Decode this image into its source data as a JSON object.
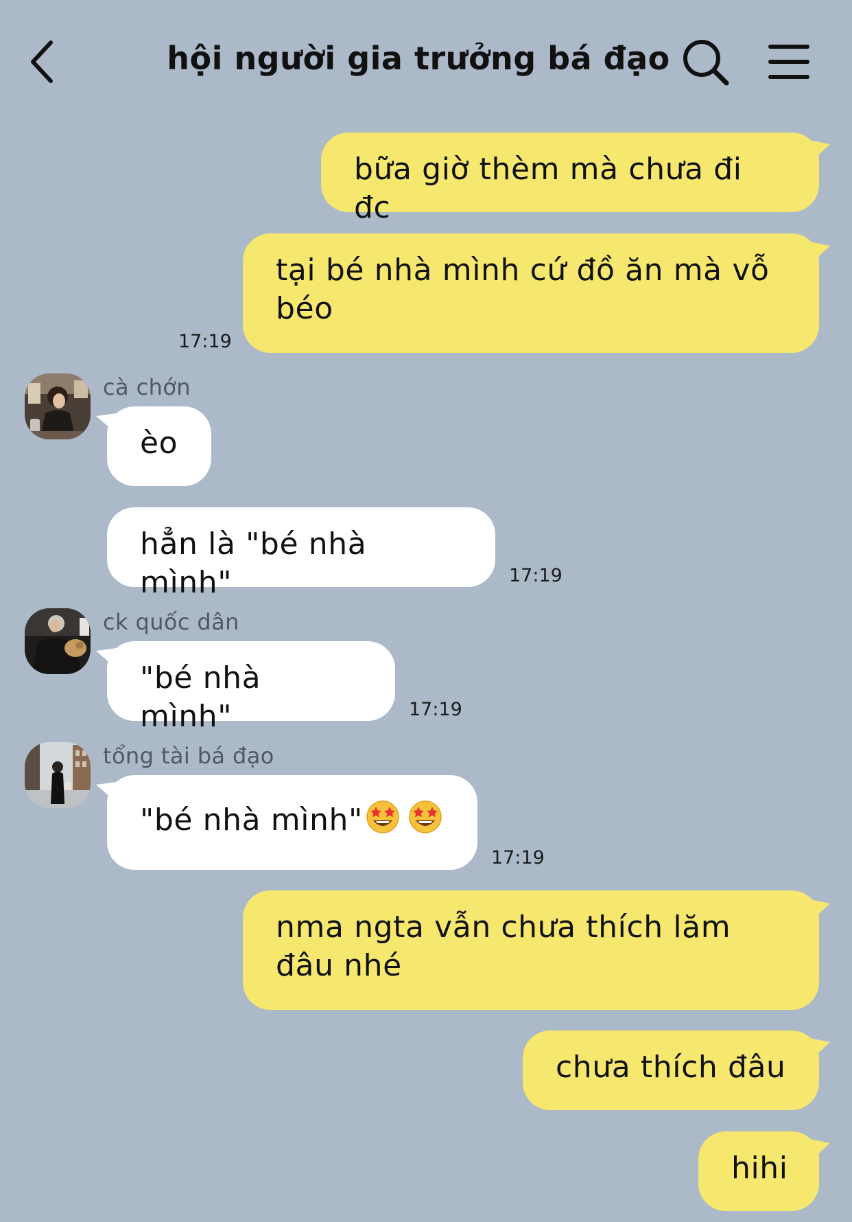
{
  "header": {
    "title": "hội người gia trưởng bá đạo",
    "back_icon": "chevron-left-icon",
    "search_icon": "search-icon",
    "menu_icon": "hamburger-menu-icon"
  },
  "colors": {
    "background": "#abb9c9",
    "outgoing_bubble": "#f6e76f",
    "incoming_bubble": "#ffffff"
  },
  "messages": [
    {
      "direction": "out",
      "text": "bữa giờ thèm mà chưa đi đc"
    },
    {
      "direction": "out",
      "lines": [
        "tại bé nhà mình cứ đồ ăn mà vỗ",
        "béo"
      ],
      "time": "17:19"
    },
    {
      "direction": "in",
      "sender": "cà chớn",
      "text": "èo"
    },
    {
      "direction": "in",
      "text": "hẳn là \"bé nhà mình\"",
      "time": "17:19"
    },
    {
      "direction": "in",
      "sender": "ck quốc dân",
      "text": "\"bé nhà mình\"",
      "time": "17:19"
    },
    {
      "direction": "in",
      "sender": "tổng tài bá đạo",
      "text": "\"bé nhà mình\"",
      "emoji": [
        "star-struck-emoji",
        "star-struck-emoji"
      ],
      "time": "17:19"
    },
    {
      "direction": "out",
      "lines": [
        "nma ngta vẫn chưa thích lăm",
        "đâu nhé"
      ]
    },
    {
      "direction": "out",
      "text": "chưa thích đâu"
    },
    {
      "direction": "out",
      "text": "hihi"
    }
  ]
}
